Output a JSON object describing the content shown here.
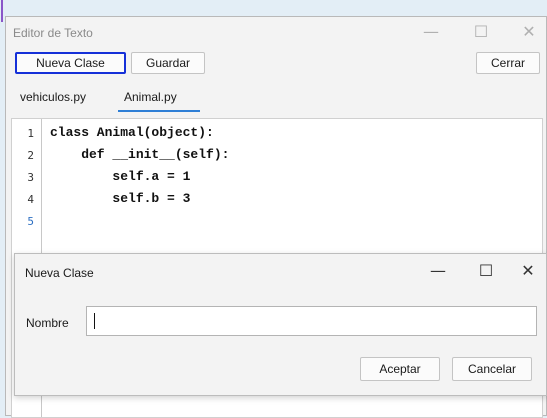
{
  "editor": {
    "title": "Editor de Texto",
    "window_controls": {
      "minimize": "—",
      "maximize": "☐",
      "close": "✕"
    },
    "toolbar": {
      "new_class_label": "Nueva Clase",
      "save_label": "Guardar",
      "close_label": "Cerrar"
    },
    "tabs": [
      {
        "label": "vehiculos.py",
        "active": false
      },
      {
        "label": "Animal.py",
        "active": true
      }
    ],
    "code": {
      "line_numbers": [
        "1",
        "2",
        "3",
        "4",
        "5"
      ],
      "lines": [
        "class Animal(object):",
        "    def __init__(self):",
        "        self.a = 1",
        "        self.b = 3",
        ""
      ]
    }
  },
  "dialog": {
    "title": "Nueva Clase",
    "window_controls": {
      "minimize": "—",
      "maximize": "☐",
      "close": "✕"
    },
    "field_label": "Nombre",
    "name_value": "",
    "accept_label": "Aceptar",
    "cancel_label": "Cancelar"
  },
  "colors": {
    "highlight_border": "#1530d8",
    "tab_underline": "#2f7fd6",
    "background": "#e3eef6"
  }
}
